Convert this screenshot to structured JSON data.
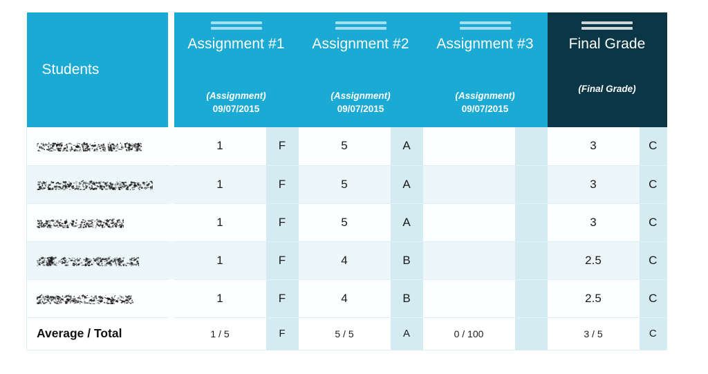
{
  "table": {
    "columns": [
      {
        "key": "students",
        "label": "Students",
        "style": "teal",
        "has_handle": false,
        "subtype": "",
        "date": ""
      },
      {
        "key": "assignment_1",
        "label": "Assignment #1",
        "style": "teal",
        "has_handle": true,
        "subtype": "(Assignment)",
        "date": "09/07/2015"
      },
      {
        "key": "assignment_2",
        "label": "Assignment #2",
        "style": "teal",
        "has_handle": true,
        "subtype": "(Assignment)",
        "date": "09/07/2015"
      },
      {
        "key": "assignment_3",
        "label": "Assignment #3",
        "style": "teal",
        "has_handle": true,
        "subtype": "(Assignment)",
        "date": "09/07/2015"
      },
      {
        "key": "final_grade",
        "label": "Final Grade",
        "style": "navy",
        "has_handle": true,
        "subtype": "(Final Grade)",
        "date": ""
      }
    ],
    "rows": [
      {
        "name": "",
        "name_redacted": true,
        "assignment_1": {
          "score": "1",
          "letter": "F"
        },
        "assignment_2": {
          "score": "5",
          "letter": "A"
        },
        "assignment_3": {
          "score": "",
          "letter": ""
        },
        "final_grade": {
          "score": "3",
          "letter": "C"
        }
      },
      {
        "name": "",
        "name_redacted": true,
        "assignment_1": {
          "score": "1",
          "letter": "F"
        },
        "assignment_2": {
          "score": "5",
          "letter": "A"
        },
        "assignment_3": {
          "score": "",
          "letter": ""
        },
        "final_grade": {
          "score": "3",
          "letter": "C"
        }
      },
      {
        "name": "",
        "name_redacted": true,
        "assignment_1": {
          "score": "1",
          "letter": "F"
        },
        "assignment_2": {
          "score": "5",
          "letter": "A"
        },
        "assignment_3": {
          "score": "",
          "letter": ""
        },
        "final_grade": {
          "score": "3",
          "letter": "C"
        }
      },
      {
        "name": "",
        "name_redacted": true,
        "assignment_1": {
          "score": "1",
          "letter": "F"
        },
        "assignment_2": {
          "score": "4",
          "letter": "B"
        },
        "assignment_3": {
          "score": "",
          "letter": ""
        },
        "final_grade": {
          "score": "2.5",
          "letter": "C"
        }
      },
      {
        "name": "",
        "name_redacted": true,
        "assignment_1": {
          "score": "1",
          "letter": "F"
        },
        "assignment_2": {
          "score": "4",
          "letter": "B"
        },
        "assignment_3": {
          "score": "",
          "letter": ""
        },
        "final_grade": {
          "score": "2.5",
          "letter": "C"
        }
      }
    ],
    "total_row": {
      "label": "Average / Total",
      "assignment_1": {
        "score": "1 / 5",
        "letter": "F"
      },
      "assignment_2": {
        "score": "5 / 5",
        "letter": "A"
      },
      "assignment_3": {
        "score": "0 / 100",
        "letter": ""
      },
      "final_grade": {
        "score": "3 / 5",
        "letter": "C"
      }
    }
  },
  "icons": {
    "drag_handle": "drag-handle-icon"
  },
  "colors": {
    "header_teal": "#1BAAD4",
    "header_navy": "#0A3646",
    "letter_column": "#D4EBF2",
    "row_alt": "#EDF6F8",
    "row_base": "#FCFEFF",
    "border": "#DCEEF4"
  }
}
